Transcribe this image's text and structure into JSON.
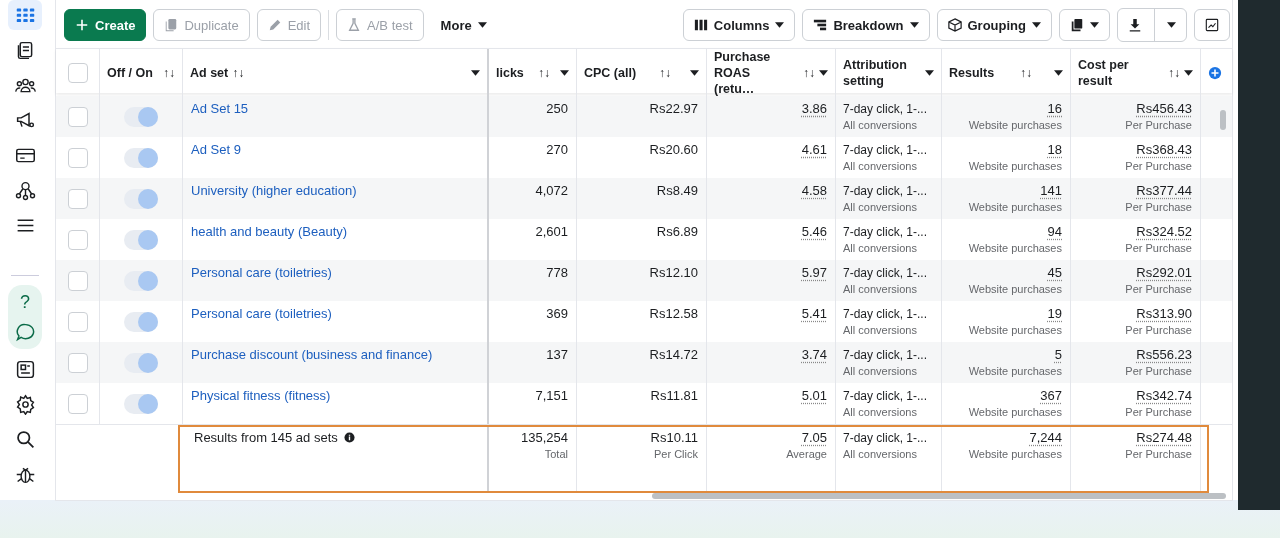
{
  "sidebar": {
    "items": [
      {
        "selected": true
      },
      {
        "selected": false
      },
      {
        "selected": false
      },
      {
        "selected": false
      },
      {
        "selected": false
      },
      {
        "selected": false
      },
      {
        "selected": false
      }
    ],
    "bottom_items": [
      {
        "label": "?",
        "selected": false
      },
      {
        "selected": false
      },
      {
        "selected": false
      },
      {
        "selected": false
      },
      {
        "selected": false
      },
      {
        "selected": false
      }
    ]
  },
  "toolbar": {
    "left": [
      {
        "kind": "primary",
        "label": "Create",
        "disabled": false
      },
      {
        "kind": "plain",
        "label": "Duplicate",
        "disabled": true
      },
      {
        "kind": "plain",
        "label": "Edit",
        "disabled": true
      },
      {
        "kind": "plain",
        "label": "A/B test",
        "disabled": true
      },
      {
        "kind": "menu",
        "label": "More",
        "disabled": false
      }
    ],
    "right": [
      {
        "kind": "plain",
        "label": "Columns"
      },
      {
        "kind": "plain",
        "label": "Breakdown"
      },
      {
        "kind": "plain",
        "label": "Grouping"
      },
      {
        "kind": "icon"
      },
      {
        "kind": "split"
      },
      {
        "kind": "icon"
      }
    ]
  },
  "table": {
    "header_checked": false,
    "columns": [
      {
        "label": "Off / On",
        "sort": "↑↓",
        "dropdown": false
      },
      {
        "label": "Ad set",
        "sort": "↑↓",
        "dropdown": true
      },
      {
        "label": "licks",
        "sort": "↑↓",
        "dropdown": true
      },
      {
        "label": "CPC (all)",
        "sort": "↑↓",
        "dropdown": true
      },
      {
        "label": "Purchase ROAS (retu…",
        "sort": "↑↓",
        "dropdown": true
      },
      {
        "label": "Attribution setting",
        "dropdown": true
      },
      {
        "label": "Results",
        "sort": "↑↓",
        "dropdown": true
      },
      {
        "label": "Cost per result",
        "sort": "↑↓",
        "dropdown": true
      }
    ],
    "rows": [
      {
        "checked": false,
        "on": true,
        "name": "Ad Set 15",
        "clicks": "250",
        "cpc": "Rs22.97",
        "roas": "3.86",
        "attribution": "7-day click, 1-...",
        "attribution_sub": "All conversions",
        "results": "16",
        "results_sub": "Website purchases",
        "cost": "Rs456.43",
        "cost_sub": "Per Purchase"
      },
      {
        "checked": false,
        "on": true,
        "name": "Ad Set 9",
        "clicks": "270",
        "cpc": "Rs20.60",
        "roas": "4.61",
        "attribution": "7-day click, 1-...",
        "attribution_sub": "All conversions",
        "results": "18",
        "results_sub": "Website purchases",
        "cost": "Rs368.43",
        "cost_sub": "Per Purchase"
      },
      {
        "checked": false,
        "on": true,
        "name": "University (higher education)",
        "clicks": "4,072",
        "cpc": "Rs8.49",
        "roas": "4.58",
        "attribution": "7-day click, 1-...",
        "attribution_sub": "All conversions",
        "results": "141",
        "results_sub": "Website purchases",
        "cost": "Rs377.44",
        "cost_sub": "Per Purchase"
      },
      {
        "checked": false,
        "on": true,
        "name": "health and beauty (Beauty)",
        "clicks": "2,601",
        "cpc": "Rs6.89",
        "roas": "5.46",
        "attribution": "7-day click, 1-...",
        "attribution_sub": "All conversions",
        "results": "94",
        "results_sub": "Website purchases",
        "cost": "Rs324.52",
        "cost_sub": "Per Purchase"
      },
      {
        "checked": false,
        "on": true,
        "name": "Personal care (toiletries)",
        "clicks": "778",
        "cpc": "Rs12.10",
        "roas": "5.97",
        "attribution": "7-day click, 1-...",
        "attribution_sub": "All conversions",
        "results": "45",
        "results_sub": "Website purchases",
        "cost": "Rs292.01",
        "cost_sub": "Per Purchase"
      },
      {
        "checked": false,
        "on": true,
        "name": "Personal care (toiletries)",
        "clicks": "369",
        "cpc": "Rs12.58",
        "roas": "5.41",
        "attribution": "7-day click, 1-...",
        "attribution_sub": "All conversions",
        "results": "19",
        "results_sub": "Website purchases",
        "cost": "Rs313.90",
        "cost_sub": "Per Purchase"
      },
      {
        "checked": false,
        "on": true,
        "name": "Purchase discount (business and finance)",
        "clicks": "137",
        "cpc": "Rs14.72",
        "roas": "3.74",
        "attribution": "7-day click, 1-...",
        "attribution_sub": "All conversions",
        "results": "5",
        "results_sub": "Website purchases",
        "cost": "Rs556.23",
        "cost_sub": "Per Purchase"
      },
      {
        "checked": false,
        "on": true,
        "name": "Physical fitness (fitness)",
        "clicks": "7,151",
        "cpc": "Rs11.81",
        "roas": "5.01",
        "attribution": "7-day click, 1-...",
        "attribution_sub": "All conversions",
        "results": "367",
        "results_sub": "Website purchases",
        "cost": "Rs342.74",
        "cost_sub": "Per Purchase"
      }
    ],
    "summary": {
      "label": "Results from 145 ad sets",
      "clicks": "135,254",
      "clicks_sub": "Total",
      "cpc": "Rs10.11",
      "cpc_sub": "Per Click",
      "roas": "7.05",
      "roas_sub": "Average",
      "attribution": "7-day click, 1-...",
      "attribution_sub": "All conversions",
      "results": "7,244",
      "results_sub": "Website purchases",
      "cost": "Rs274.48",
      "cost_sub": "Per Purchase"
    }
  }
}
